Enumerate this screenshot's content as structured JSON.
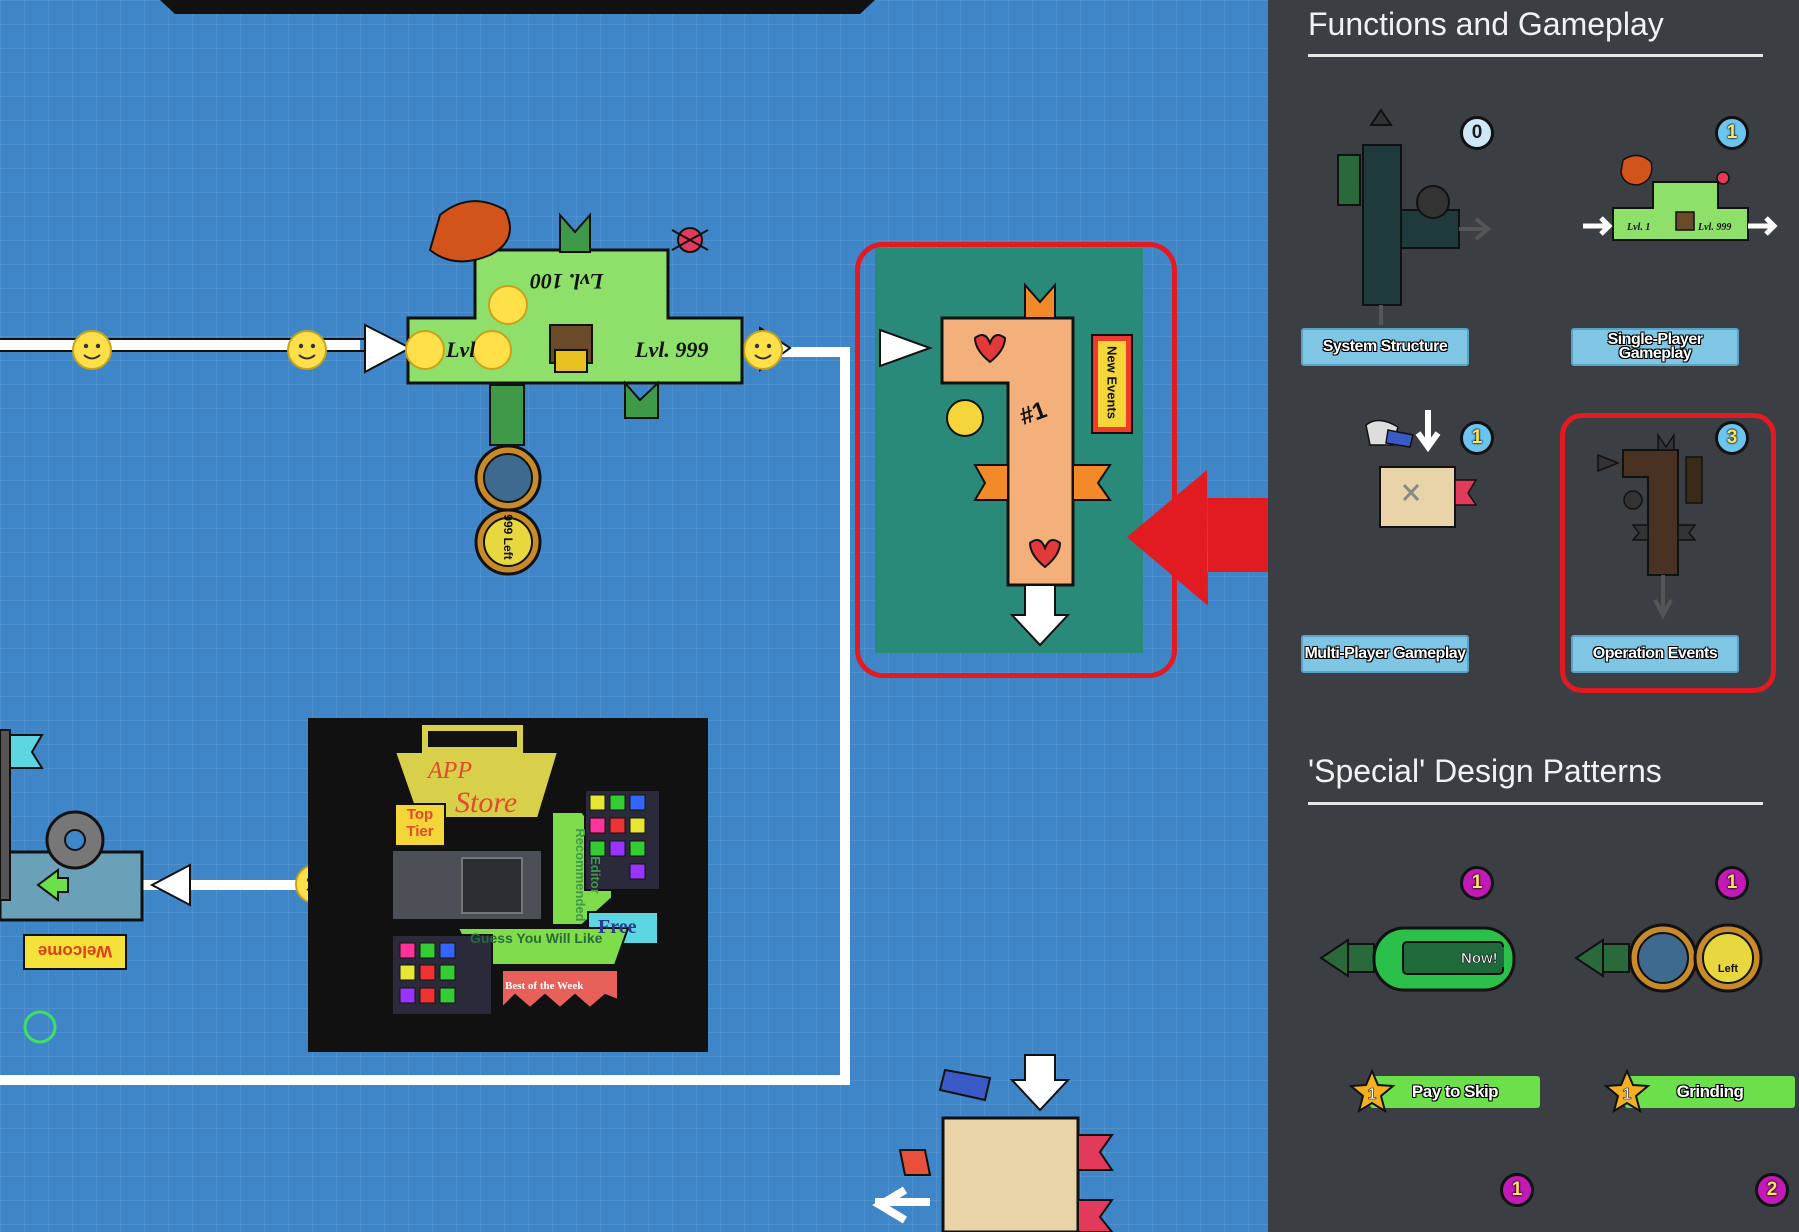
{
  "canvas": {
    "level_block": {
      "top_label": "Lvl. 100",
      "left_label": "Lvl",
      "right_label": "Lvl. 999"
    },
    "counter_label": "999 Left",
    "app_store": {
      "title_line1": "APP",
      "title_line2": "Store",
      "top_tier": "Top Tier",
      "editor_recommended": "Editor Recommended",
      "free": "Free",
      "guess": "Guess You Will Like",
      "best": "Best of the Week"
    },
    "welcome_sign": "Welcome",
    "events_block": {
      "sign": "New Events",
      "number": "#1"
    }
  },
  "panel": {
    "functions": {
      "title": "Functions and Gameplay",
      "cards": [
        {
          "label": "System Structure",
          "count": "0"
        },
        {
          "label": "Single-Player Gameplay",
          "count": "1"
        },
        {
          "label": "Multi-Player Gameplay",
          "count": "1"
        },
        {
          "label": "Operation Events",
          "count": "3"
        }
      ]
    },
    "special": {
      "title": "'Special' Design Patterns",
      "cards": [
        {
          "label": "Pay to Skip",
          "count": "1",
          "star": "1",
          "thumb_text": "Now!"
        },
        {
          "label": "Grinding",
          "count": "1",
          "star": "1",
          "thumb_text": "Left"
        },
        {
          "count": "1"
        },
        {
          "count": "2"
        }
      ]
    }
  },
  "colors": {
    "canvas_bg": "#3f86c9",
    "panel_bg": "#3b3f44",
    "highlight": "#e21a22",
    "category_label": "#7fc6e4",
    "pattern_label": "#6be04a",
    "badge_magenta": "#c21ab6"
  }
}
